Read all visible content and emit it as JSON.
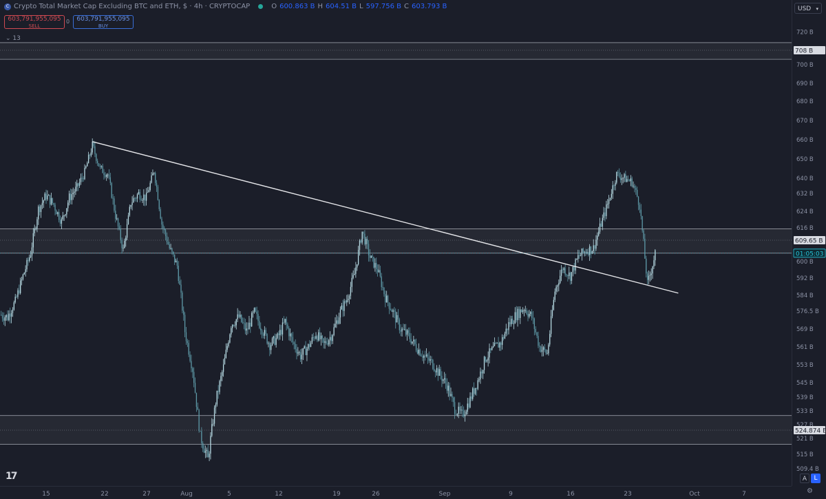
{
  "header": {
    "symbol_badge": "C",
    "title": "Crypto Total Market Cap Excluding BTC and ETH, $ · 4h · CRYPTOCAP",
    "open_label": "O",
    "open": "600.863 B",
    "high_label": "H",
    "high": "604.51 B",
    "low_label": "L",
    "low": "597.756 B",
    "close_label": "C",
    "close": "603.793 B",
    "sell_price": "603,791,955,095",
    "sell_label": "SELL",
    "spread": "0",
    "buy_price": "603,791,955,095",
    "buy_label": "BUY",
    "indicators_count": "13",
    "currency": "USD"
  },
  "controls": {
    "auto_label": "A",
    "log_label": "L",
    "gear_icon": "gear-icon",
    "logo_text": "17"
  },
  "colors": {
    "background": "#1b1e29",
    "candle": "#b9dde6",
    "candle_dark": "#5e9aa8",
    "trendline": "#e6e7ea",
    "zone": "#c8ccd6",
    "accent": "#2962ff",
    "sell": "#d04a52",
    "live": "#26c6da"
  },
  "chart_data": {
    "type": "candlestick",
    "title": "Crypto Total Market Cap Excluding BTC and ETH",
    "timeframe": "4h",
    "x_ticks": [
      "15",
      "22",
      "27",
      "Aug",
      "5",
      "12",
      "19",
      "26",
      "Sep",
      "9",
      "16",
      "23",
      "Oct",
      "7"
    ],
    "y_ticks": [
      "720B",
      "708B",
      "700B",
      "690B",
      "680B",
      "670B",
      "660B",
      "650B",
      "640B",
      "632B",
      "624B",
      "616B",
      "609.65B",
      "600B",
      "592B",
      "584B",
      "576.5B",
      "569B",
      "561B",
      "553B",
      "545B",
      "539B",
      "533B",
      "527B",
      "524.874B",
      "521B",
      "515B",
      "509.4B"
    ],
    "ylim": [
      508,
      722
    ],
    "price_path": [
      {
        "x": "Jul 09",
        "y": 575
      },
      {
        "x": "Jul 10",
        "y": 574
      },
      {
        "x": "Jul 11",
        "y": 581
      },
      {
        "x": "Jul 12",
        "y": 593
      },
      {
        "x": "Jul 13",
        "y": 604
      },
      {
        "x": "Jul 14",
        "y": 625
      },
      {
        "x": "Jul 15",
        "y": 631
      },
      {
        "x": "Jul 16",
        "y": 627
      },
      {
        "x": "Jul 17",
        "y": 619
      },
      {
        "x": "Jul 18",
        "y": 630
      },
      {
        "x": "Jul 19",
        "y": 635
      },
      {
        "x": "Jul 20",
        "y": 643
      },
      {
        "x": "Jul 21",
        "y": 657
      },
      {
        "x": "Jul 22",
        "y": 645
      },
      {
        "x": "Jul 23",
        "y": 642
      },
      {
        "x": "Jul 24",
        "y": 622
      },
      {
        "x": "Jul 25",
        "y": 605
      },
      {
        "x": "Jul 26",
        "y": 628
      },
      {
        "x": "Jul 27",
        "y": 632
      },
      {
        "x": "Jul 28",
        "y": 630
      },
      {
        "x": "Jul 29",
        "y": 644
      },
      {
        "x": "Jul 30",
        "y": 618
      },
      {
        "x": "Jul 31",
        "y": 606
      },
      {
        "x": "Aug 01",
        "y": 598
      },
      {
        "x": "Aug 02",
        "y": 568
      },
      {
        "x": "Aug 03",
        "y": 551
      },
      {
        "x": "Aug 04",
        "y": 522
      },
      {
        "x": "Aug 05",
        "y": 513
      },
      {
        "x": "Aug 06",
        "y": 537
      },
      {
        "x": "Aug 07",
        "y": 552
      },
      {
        "x": "Aug 08",
        "y": 571
      },
      {
        "x": "Aug 09",
        "y": 574
      },
      {
        "x": "Aug 10",
        "y": 568
      },
      {
        "x": "Aug 11",
        "y": 576
      },
      {
        "x": "Aug 12",
        "y": 569
      },
      {
        "x": "Aug 13",
        "y": 562
      },
      {
        "x": "Aug 14",
        "y": 565
      },
      {
        "x": "Aug 15",
        "y": 572
      },
      {
        "x": "Aug 16",
        "y": 563
      },
      {
        "x": "Aug 17",
        "y": 557
      },
      {
        "x": "Aug 18",
        "y": 561
      },
      {
        "x": "Aug 19",
        "y": 567
      },
      {
        "x": "Aug 20",
        "y": 562
      },
      {
        "x": "Aug 21",
        "y": 566
      },
      {
        "x": "Aug 22",
        "y": 575
      },
      {
        "x": "Aug 23",
        "y": 582
      },
      {
        "x": "Aug 24",
        "y": 594
      },
      {
        "x": "Aug 25",
        "y": 614
      },
      {
        "x": "Aug 26",
        "y": 602
      },
      {
        "x": "Aug 27",
        "y": 596
      },
      {
        "x": "Aug 28",
        "y": 583
      },
      {
        "x": "Aug 29",
        "y": 576
      },
      {
        "x": "Aug 30",
        "y": 569
      },
      {
        "x": "Aug 31",
        "y": 566
      },
      {
        "x": "Sep 01",
        "y": 561
      },
      {
        "x": "Sep 02",
        "y": 557
      },
      {
        "x": "Sep 03",
        "y": 554
      },
      {
        "x": "Sep 04",
        "y": 549
      },
      {
        "x": "Sep 05",
        "y": 544
      },
      {
        "x": "Sep 06",
        "y": 534
      },
      {
        "x": "Sep 07",
        "y": 531
      },
      {
        "x": "Sep 08",
        "y": 538
      },
      {
        "x": "Sep 09",
        "y": 546
      },
      {
        "x": "Sep 10",
        "y": 556
      },
      {
        "x": "Sep 11",
        "y": 560
      },
      {
        "x": "Sep 12",
        "y": 563
      },
      {
        "x": "Sep 13",
        "y": 571
      },
      {
        "x": "Sep 14",
        "y": 575
      },
      {
        "x": "Sep 15",
        "y": 578
      },
      {
        "x": "Sep 16",
        "y": 574
      },
      {
        "x": "Sep 17",
        "y": 561
      },
      {
        "x": "Sep 18",
        "y": 558
      },
      {
        "x": "Sep 19",
        "y": 586
      },
      {
        "x": "Sep 20",
        "y": 597
      },
      {
        "x": "Sep 21",
        "y": 593
      },
      {
        "x": "Sep 22",
        "y": 602
      },
      {
        "x": "Sep 23",
        "y": 605
      },
      {
        "x": "Sep 24",
        "y": 606
      },
      {
        "x": "Sep 25",
        "y": 618
      },
      {
        "x": "Sep 26",
        "y": 629
      },
      {
        "x": "Sep 27",
        "y": 642
      },
      {
        "x": "Sep 28",
        "y": 640
      },
      {
        "x": "Sep 29",
        "y": 638
      },
      {
        "x": "Sep 30",
        "y": 627
      },
      {
        "x": "Oct 01",
        "y": 589
      },
      {
        "x": "Oct 01 12:00",
        "y": 596
      },
      {
        "x": "Oct 02",
        "y": 603.793
      }
    ],
    "trendline": {
      "from": {
        "x": "Jul 21",
        "y": 659
      },
      "to": {
        "x": "Oct 05",
        "y": 585
      }
    },
    "zones": [
      {
        "label": "708 B",
        "top": 713,
        "bottom": 703,
        "mid": 708
      },
      {
        "label": "609.65 B",
        "top": 615.5,
        "bottom": 603.8,
        "mid": 609.65
      },
      {
        "label": "524.874 B",
        "top": 531,
        "bottom": 518.8,
        "mid": 524.874
      }
    ],
    "current_price": {
      "value": 603.793,
      "countdown": "01:05:03"
    },
    "grid": false
  }
}
